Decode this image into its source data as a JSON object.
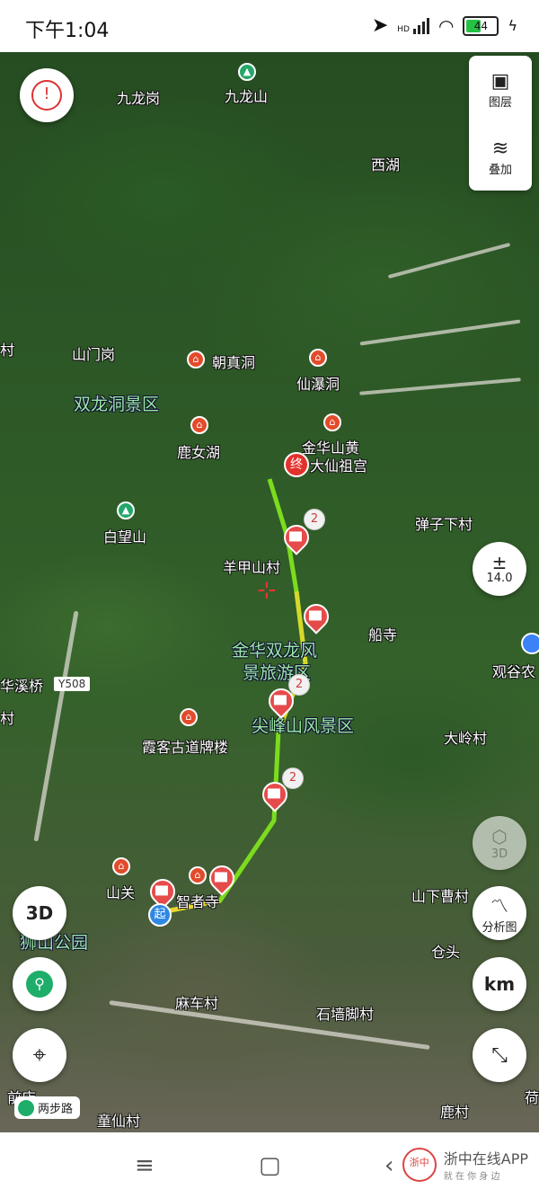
{
  "status": {
    "time": "下午1:04",
    "hd": "HD",
    "battery": "44",
    "battery_level": 0.44
  },
  "map": {
    "labels": {
      "jiulonggang": "九龙岗",
      "jiulongshan": "九龙山",
      "xihu": "西湖",
      "shanmengang": "山门岗",
      "zhaozhendong": "朝真洞",
      "xianpudong": "仙瀑洞",
      "shuanglongdong": "双龙洞景区",
      "lunvhu": "鹿女湖",
      "jinhuashan": "金华山黄",
      "daxianzugong": "大仙祖宫",
      "baiwangshan": "白望山",
      "danzixiacun": "弹子下村",
      "yangjiashancun": "羊甲山村",
      "chuansi": "船寺",
      "guangunong": "观谷农",
      "jinhuashuanglong1": "金华双龙风",
      "jinhuashuanglong2": "景旅游区",
      "huaxiqiao": "华溪桥",
      "jianfengshan": "尖峰山风景区",
      "xiakegudao": "霞客古道牌楼",
      "dalingcun": "大岭村",
      "shanguan": "山关",
      "zhizhesi": "智者寺",
      "shanxiacaocun": "山下曹村",
      "shishangongyuan": "狮山公园",
      "cangtou": "仓头",
      "macun": "麻车村",
      "shiqiangjiaocun": "石墙脚村",
      "qiandian": "前店",
      "tongxiancun": "童仙村",
      "lucun": "鹿村",
      "cun_left": "村",
      "cun_left2": "村",
      "he": "荷",
      "road_y508": "Y508"
    },
    "markers": {
      "end": "终",
      "start": "起",
      "badge1": "2",
      "badge2": "2",
      "badge3": "2"
    },
    "road_tag": "两步路"
  },
  "controls": {
    "layers_label": "图层",
    "overlay_label": "叠加",
    "zoom_level": "14.0",
    "btn_3d": "3D",
    "btn_3d_disabled": "3D",
    "analysis_label": "分析图",
    "unit_label": "km"
  },
  "nav": {
    "watermark": "浙中在线APP",
    "watermark_sub": "就 在 你 身 边",
    "watermark_logo": "浙中"
  }
}
